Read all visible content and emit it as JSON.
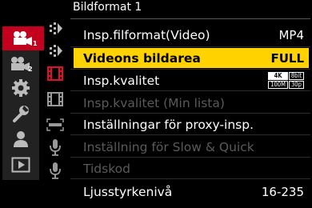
{
  "menu": {
    "title": "Bildformat 1"
  },
  "categories": [
    {
      "icon": "video-camera-icon",
      "sub": "1",
      "active": true
    },
    {
      "icon": "video-camera-icon",
      "sub": "2",
      "active": false
    },
    {
      "icon": "gear-icon",
      "sub": "",
      "active": false
    },
    {
      "icon": "wrench-icon",
      "sub": "",
      "active": false
    },
    {
      "icon": "person-icon",
      "sub": "",
      "active": false
    },
    {
      "icon": "playback-icon",
      "sub": "",
      "active": false
    }
  ],
  "tabs": [
    {
      "icon": "image-format-icon"
    },
    {
      "icon": "image-format-icon"
    },
    {
      "icon": "film-strip-icon"
    },
    {
      "icon": "film-strip-icon"
    },
    {
      "icon": "focus-icon"
    },
    {
      "icon": "microphone-icon"
    },
    {
      "icon": "microphone-icon"
    }
  ],
  "items": [
    {
      "label": "Insp.filformat(Video)",
      "value": "MP4",
      "state": "normal"
    },
    {
      "label": "Videons bildarea",
      "value": "FULL",
      "state": "selected"
    },
    {
      "label": "Insp.kvalitet",
      "value": "",
      "state": "normal",
      "badge": [
        "4K",
        "8bit",
        "100M",
        "30p"
      ]
    },
    {
      "label": "Insp.kvalitet (Min lista)",
      "value": "",
      "state": "disabled"
    },
    {
      "label": "Inställningar för proxy-insp.",
      "value": "",
      "state": "normal"
    },
    {
      "label": "Inställning för Slow & Quick",
      "value": "",
      "state": "disabled"
    },
    {
      "label": "Tidskod",
      "value": "",
      "state": "disabled"
    },
    {
      "label": "Ljusstyrkenivå",
      "value": "16-235",
      "state": "normal"
    }
  ],
  "colors": {
    "accent_red": "#c4001f",
    "highlight_yellow": "#ffd200",
    "disabled_text": "#5a5a5a"
  }
}
